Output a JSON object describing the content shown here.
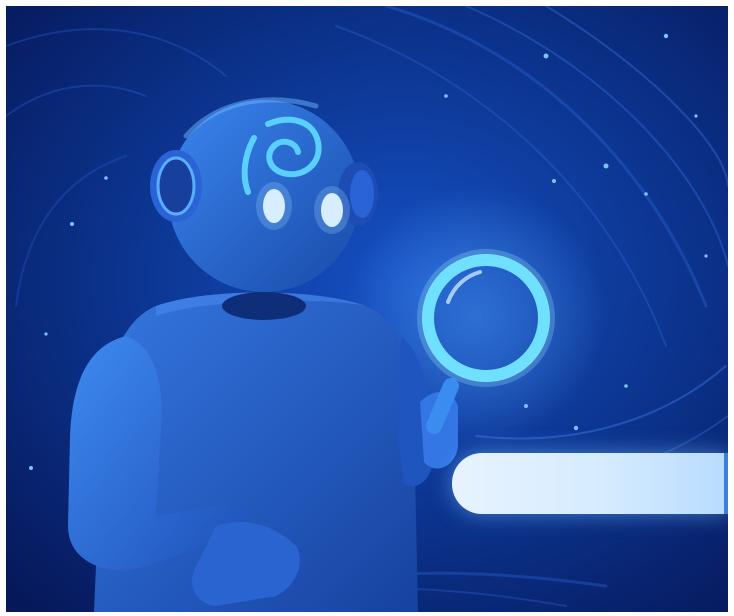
{
  "scene": {
    "background_color": "#0a2a78",
    "accent_color": "#4fc3ff",
    "robot_color": "#2f6fe0",
    "icons": [
      "spiral-icon",
      "magnifying-glass-icon",
      "search-icon"
    ]
  },
  "search": {
    "value": "",
    "placeholder": "",
    "button_icon": "search-icon"
  }
}
